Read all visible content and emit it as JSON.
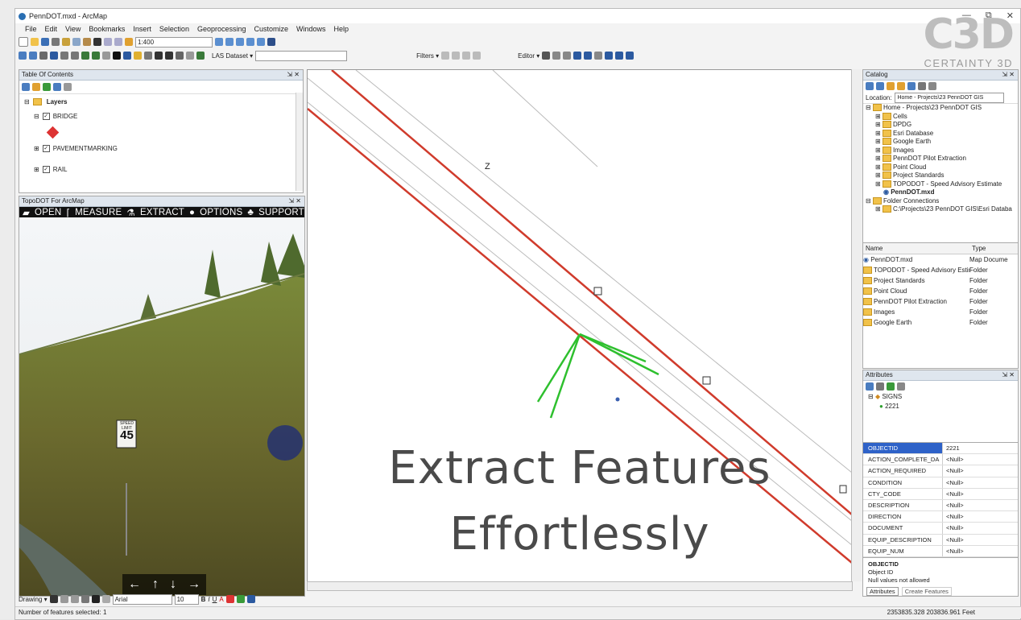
{
  "window": {
    "title": "PennDOT.mxd - ArcMap",
    "controls": [
      "—",
      "⧉",
      "✕"
    ]
  },
  "menu": [
    "File",
    "Edit",
    "View",
    "Bookmarks",
    "Insert",
    "Selection",
    "Geoprocessing",
    "Customize",
    "Windows",
    "Help"
  ],
  "toolbar": {
    "scale": "1:400",
    "las_dataset_label": "LAS Dataset ▾",
    "filters_label": "Filters ▾",
    "editor_label": "Editor ▾"
  },
  "brand": {
    "logo_text": "C3D",
    "name": "CERTAINTY 3D"
  },
  "toc": {
    "title": "Table Of Contents",
    "layers_label": "Layers",
    "layers": [
      "BRIDGE",
      "PAVEMENTMARKING",
      "RAIL"
    ]
  },
  "topodot": {
    "title": "TopoDOT For ArcMap",
    "menu": [
      "OPEN",
      "MEASURE",
      "EXTRACT",
      "OPTIONS",
      "SUPPORT"
    ],
    "sign_title": "SPEED LIMIT",
    "sign_value": "45",
    "nav": [
      "←",
      "↑",
      "↓",
      "→"
    ]
  },
  "map": {
    "headline_line1": "Extract Features",
    "headline_line2": "Effortlessly",
    "label_z": "Z"
  },
  "catalog": {
    "title": "Catalog",
    "location_label": "Location:",
    "location_value": "Home - Projects\\23 PennDOT GIS",
    "tree": [
      "Home - Projects\\23 PennDOT GIS",
      "Cells",
      "DPDG",
      "Esri Database",
      "Google Earth",
      "Images",
      "PennDOT Pilot Extraction",
      "Point Cloud",
      "Project Standards",
      "TOPODOT - Speed Advisory Estimate",
      "PennDOT.mxd",
      "Folder Connections",
      "C:\\Projects\\23 PennDOT GIS\\Esri Databa"
    ],
    "list_headers": [
      "Name",
      "Type"
    ],
    "list": [
      [
        "PennDOT.mxd",
        "Map Docume"
      ],
      [
        "TOPODOT - Speed Advisory Estim.",
        "Folder"
      ],
      [
        "Project Standards",
        "Folder"
      ],
      [
        "Point Cloud",
        "Folder"
      ],
      [
        "PennDOT Pilot Extraction",
        "Folder"
      ],
      [
        "Images",
        "Folder"
      ],
      [
        "Google Earth",
        "Folder"
      ]
    ]
  },
  "attributes": {
    "title": "Attributes",
    "layer": "SIGNS",
    "feature": "2221",
    "rows": [
      [
        "OBJECTID",
        "2221"
      ],
      [
        "ACTION_COMPLETE_DA",
        "<Null>"
      ],
      [
        "ACTION_REQUIRED",
        "<Null>"
      ],
      [
        "CONDITION",
        "<Null>"
      ],
      [
        "CTY_CODE",
        "<Null>"
      ],
      [
        "DESCRIPTION",
        "<Null>"
      ],
      [
        "DIRECTION",
        "<Null>"
      ],
      [
        "DOCUMENT",
        "<Null>"
      ],
      [
        "EQUIP_DESCRIPTION",
        "<Null>"
      ],
      [
        "EQUIP_NUM",
        "<Null>"
      ]
    ],
    "field_name": "OBJECTID",
    "field_desc": "Object ID",
    "field_null": "Null values not allowed",
    "tab_attributes": "Attributes",
    "tab_create": "Create Features"
  },
  "bottom": {
    "drawing_label": "Drawing ▾",
    "font": "Arial",
    "size": "10"
  },
  "status": {
    "left": "Number of features selected: 1",
    "coords": "2353835.328  203836.961 Feet"
  }
}
